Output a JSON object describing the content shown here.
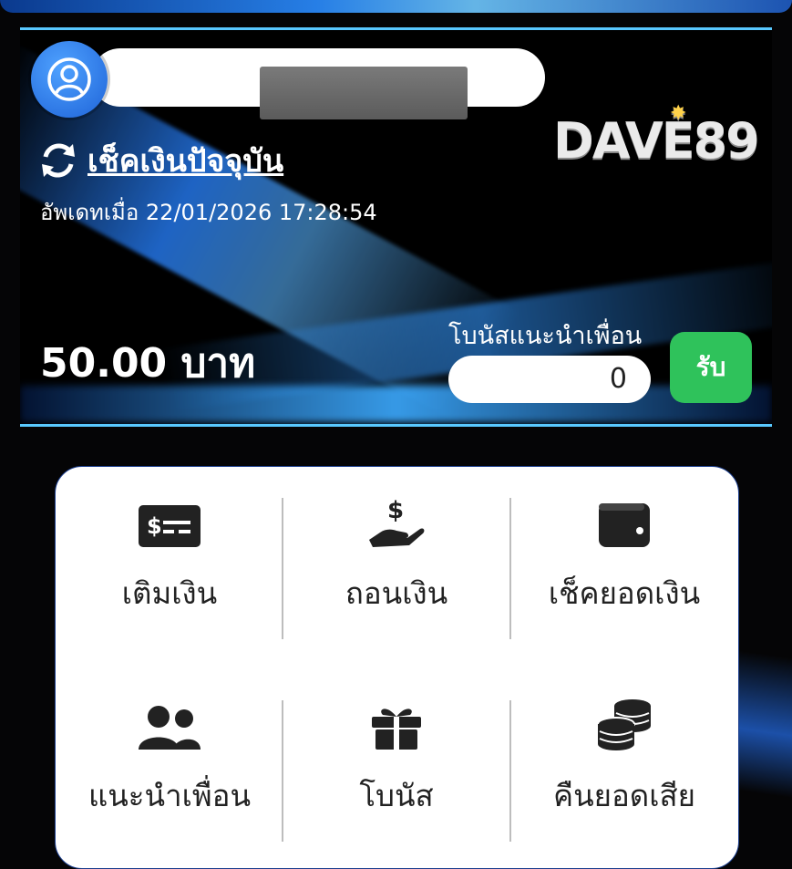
{
  "header": {
    "check_balance_label": "เช็คเงินปัจจุบัน",
    "updated_text": "อัพเดทเมื่อ 22/01/2026 17:28:54",
    "balance_text": "50.00 บาท",
    "logo_text": "DAVE89"
  },
  "referral": {
    "label": "โบนัสแนะนำเพื่อน",
    "value": "0",
    "claim_label": "รับ"
  },
  "menu": {
    "items": [
      {
        "label": "เติมเงิน",
        "icon": "money-bill-icon"
      },
      {
        "label": "ถอนเงิน",
        "icon": "hand-dollar-icon"
      },
      {
        "label": "เช็คยอดเงิน",
        "icon": "wallet-icon"
      },
      {
        "label": "แนะนำเพื่อน",
        "icon": "users-icon"
      },
      {
        "label": "โบนัส",
        "icon": "gift-icon"
      },
      {
        "label": "คืนยอดเสีย",
        "icon": "coins-icon"
      }
    ]
  },
  "colors": {
    "accent_blue": "#1e63d8",
    "claim_green": "#2fc25b",
    "card_edge": "#59c9ff"
  }
}
